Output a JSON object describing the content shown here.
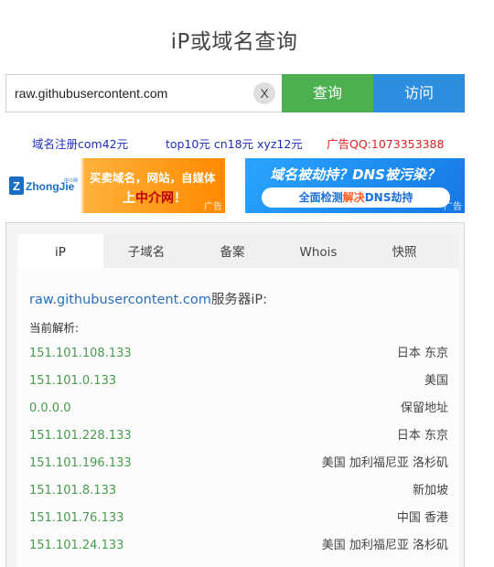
{
  "page_title": "iP或域名查询",
  "search": {
    "value": "raw.githubusercontent.com",
    "clear_label": "X",
    "query_label": "查询",
    "visit_label": "访问"
  },
  "promo_links": [
    {
      "text": "域名注册com42元",
      "color": "#1d2fb8"
    },
    {
      "text": "top10元 cn18元 xyz12元",
      "color": "#1d2fb8"
    },
    {
      "text": "广告QQ:1073353388",
      "color": "#e02020"
    }
  ],
  "ads": {
    "left": {
      "logo_text": "ZhongJie",
      "logo_sub": "中介网",
      "line1": "买卖域名，网站，自媒体",
      "line2_prefix": "上",
      "line2_highlight": "中介网",
      "line2_suffix": "！",
      "tag": "广告"
    },
    "right": {
      "line1": "域名被劫持？DNS被污染？",
      "pill_prefix": "全面检测",
      "pill_highlight": "解决",
      "pill_suffix": "DNS劫持",
      "tag": "广告"
    }
  },
  "tabs": [
    {
      "label": "iP",
      "active": true
    },
    {
      "label": "子域名",
      "active": false
    },
    {
      "label": "备案",
      "active": false
    },
    {
      "label": "Whois",
      "active": false
    },
    {
      "label": "快照",
      "active": false
    }
  ],
  "result": {
    "domain": "raw.githubusercontent.com",
    "title_suffix": "服务器iP:",
    "current_label": "当前解析:",
    "rows": [
      {
        "ip": "151.101.108.133",
        "location": "日本 东京"
      },
      {
        "ip": "151.101.0.133",
        "location": "美国"
      },
      {
        "ip": "0.0.0.0",
        "location": "保留地址"
      },
      {
        "ip": "151.101.228.133",
        "location": "日本 东京"
      },
      {
        "ip": "151.101.196.133",
        "location": "美国 加利福尼亚 洛杉矶"
      },
      {
        "ip": "151.101.8.133",
        "location": "新加坡"
      },
      {
        "ip": "151.101.76.133",
        "location": "中国 香港"
      },
      {
        "ip": "151.101.24.133",
        "location": "美国 加利福尼亚 洛杉矶"
      }
    ]
  },
  "colors": {
    "query_button": "#4caf50",
    "visit_button": "#2d8ee0",
    "ip_text": "#4a9a50",
    "domain_link": "#2a6ebb"
  }
}
